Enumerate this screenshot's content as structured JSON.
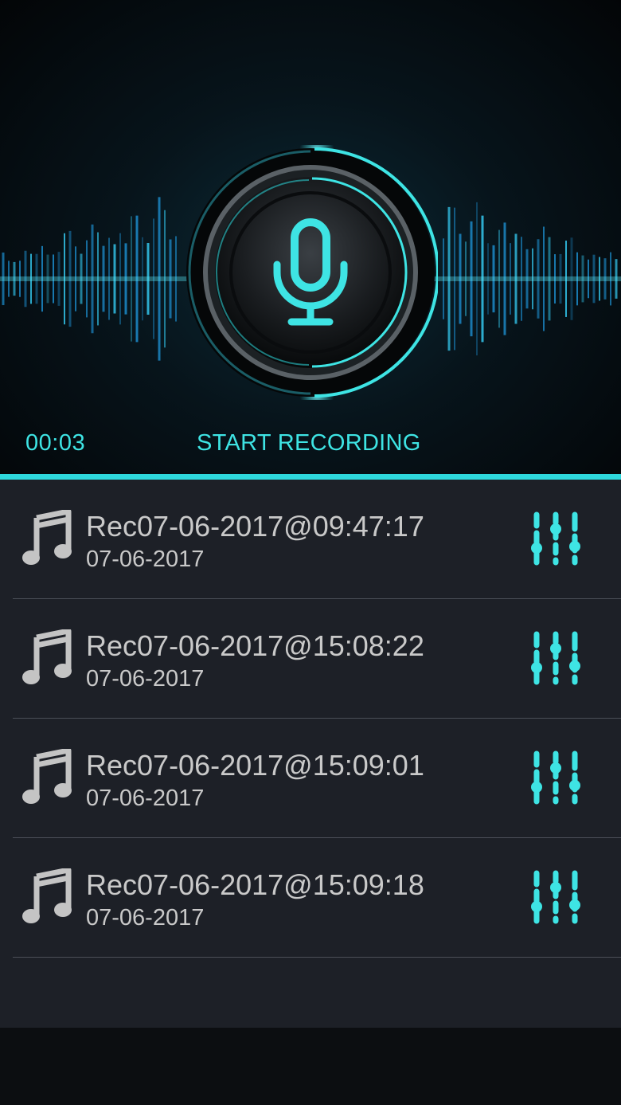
{
  "colors": {
    "accent": "#3ee4e4",
    "divider": "#2ed8dc",
    "list_bg": "#1d2027",
    "text": "#c9c9c9",
    "icon_gray": "#c4c4c4"
  },
  "header": {
    "timer": "00:03",
    "start_label": "START RECORDING",
    "mic_icon": "microphone-icon"
  },
  "recordings": [
    {
      "name": "Rec07-06-2017@09:47:17",
      "date": "07-06-2017"
    },
    {
      "name": "Rec07-06-2017@15:08:22",
      "date": "07-06-2017"
    },
    {
      "name": "Rec07-06-2017@15:09:01",
      "date": "07-06-2017"
    },
    {
      "name": "Rec07-06-2017@15:09:18",
      "date": "07-06-2017"
    }
  ],
  "icons": {
    "row_icon": "music-note-icon",
    "action_icon": "equalizer-icon"
  }
}
